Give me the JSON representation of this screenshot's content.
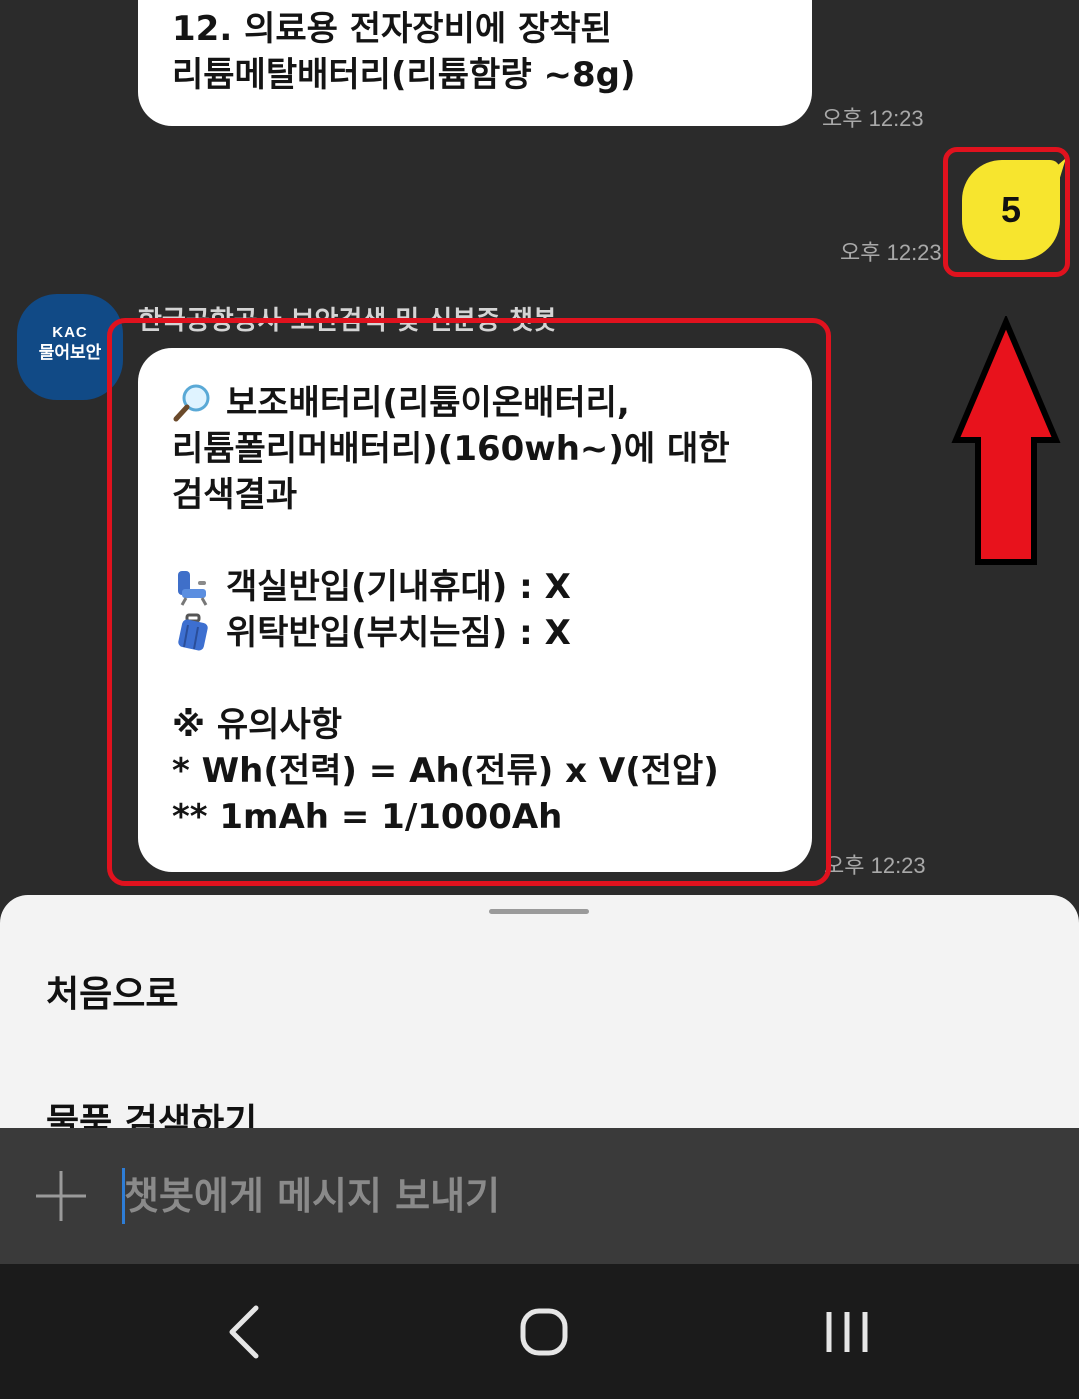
{
  "messages": {
    "first": {
      "line1": "12. 의료용 전자장비에 장착된",
      "line2": "리튬메탈배터리(리튬함량 ~8g)",
      "time": "오후 12:23"
    },
    "mine": {
      "text": "5",
      "time": "오후 12:23",
      "color": "#f7e52e"
    },
    "bot": {
      "sender": "한국공항공사 보안검색 및 신분증 챗봇",
      "avatar_line1": "KAC",
      "avatar_line2": "물어보안",
      "line1": "보조배터리(리튬이온배터리,",
      "line2": "리튬폴리머배터리)(160wh~)에 대한",
      "line3": "검색결과",
      "cabin": "객실반입(기내휴대) : X",
      "checked": "위탁반입(부치는짐) : X",
      "notice_title": "※ 유의사항",
      "notice1": "* Wh(전력) = Ah(전류) x V(전압)",
      "notice2": "** 1mAh = 1/1000Ah",
      "time": "오후 12:23",
      "icons": [
        "magnifier-icon",
        "seat-icon",
        "suitcase-icon"
      ]
    }
  },
  "sheet": {
    "items": [
      "처음으로",
      "물품 검색하기"
    ]
  },
  "input": {
    "placeholder": "챗봇에게 메시지 보내기",
    "attach_icon": "plus-icon"
  },
  "navbar": {
    "icons": [
      "back-icon",
      "home-icon",
      "recents-icon"
    ]
  },
  "annotation": {
    "color": "#e0121e",
    "arrow_icon": "red-up-arrow"
  }
}
